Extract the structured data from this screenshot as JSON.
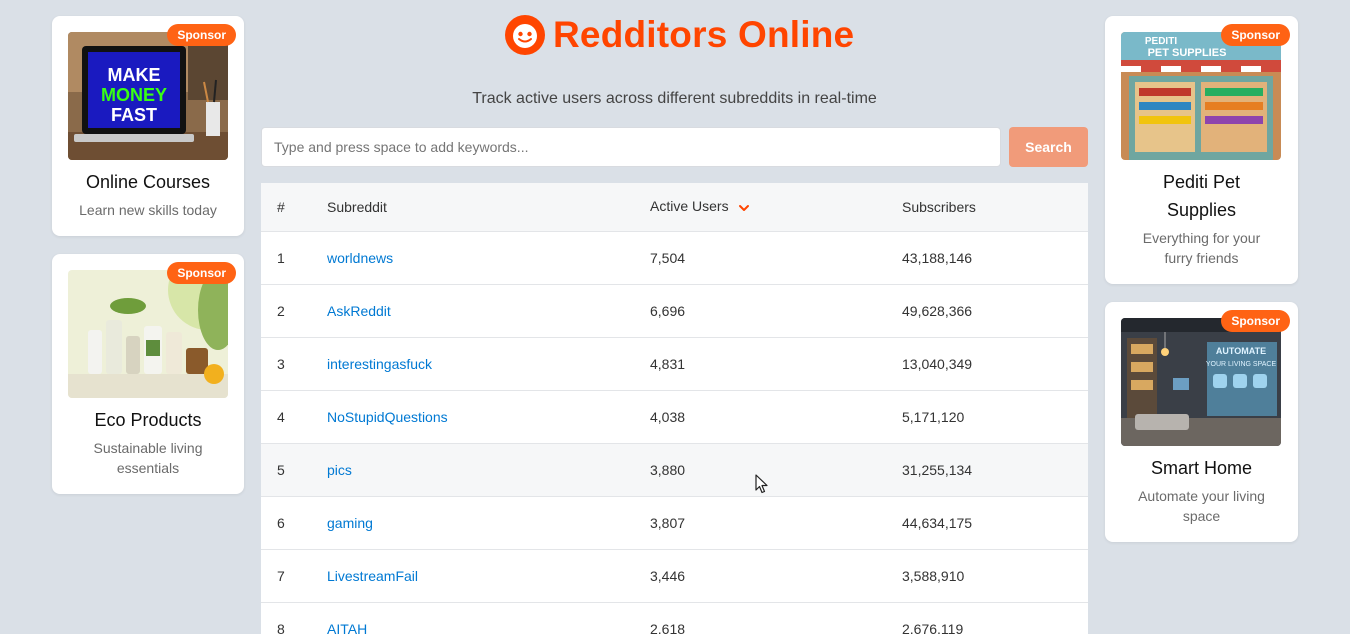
{
  "header": {
    "title": "Redditors Online",
    "subtitle": "Track active users across different subreddits in real-time"
  },
  "search": {
    "placeholder": "Type and press space to add keywords...",
    "value": "",
    "button_label": "Search"
  },
  "table": {
    "columns": [
      "#",
      "Subreddit",
      "Active Users",
      "Subscribers"
    ],
    "sort": {
      "column": "Active Users",
      "direction": "descending"
    },
    "rows": [
      {
        "rank": "1",
        "subreddit": "worldnews",
        "active": "7,504",
        "subscribers": "43,188,146"
      },
      {
        "rank": "2",
        "subreddit": "AskReddit",
        "active": "6,696",
        "subscribers": "49,628,366"
      },
      {
        "rank": "3",
        "subreddit": "interestingasfuck",
        "active": "4,831",
        "subscribers": "13,040,349"
      },
      {
        "rank": "4",
        "subreddit": "NoStupidQuestions",
        "active": "4,038",
        "subscribers": "5,171,120"
      },
      {
        "rank": "5",
        "subreddit": "pics",
        "active": "3,880",
        "subscribers": "31,255,134"
      },
      {
        "rank": "6",
        "subreddit": "gaming",
        "active": "3,807",
        "subscribers": "44,634,175"
      },
      {
        "rank": "7",
        "subreddit": "LivestreamFail",
        "active": "3,446",
        "subscribers": "3,588,910"
      },
      {
        "rank": "8",
        "subreddit": "AITAH",
        "active": "2,618",
        "subscribers": "2,676,119"
      }
    ]
  },
  "sponsors": {
    "badge": "Sponsor",
    "left": [
      {
        "title": "Online Courses",
        "description": "Learn new skills today",
        "image_text": [
          "MAKE",
          "MONEY",
          "FAST"
        ]
      },
      {
        "title": "Eco Products",
        "description": "Sustainable living essentials"
      }
    ],
    "right": [
      {
        "title": "Pediti Pet Supplies",
        "description": "Everything for your furry friends",
        "image_text": [
          "PEDITI",
          "PET SUPPLIES"
        ]
      },
      {
        "title": "Smart Home",
        "description": "Automate your living space",
        "image_text": [
          "AUTOMATE",
          "YOUR LIVING SPACE"
        ]
      }
    ]
  },
  "colors": {
    "brand": "#ff4500",
    "badge": "#ff6314",
    "link": "#0079d3",
    "background": "#dae0e7",
    "search_button": "#f19b7a"
  },
  "icons": [
    "reddit-logo-icon",
    "sort-descending-icon",
    "mouse-cursor-icon"
  ]
}
